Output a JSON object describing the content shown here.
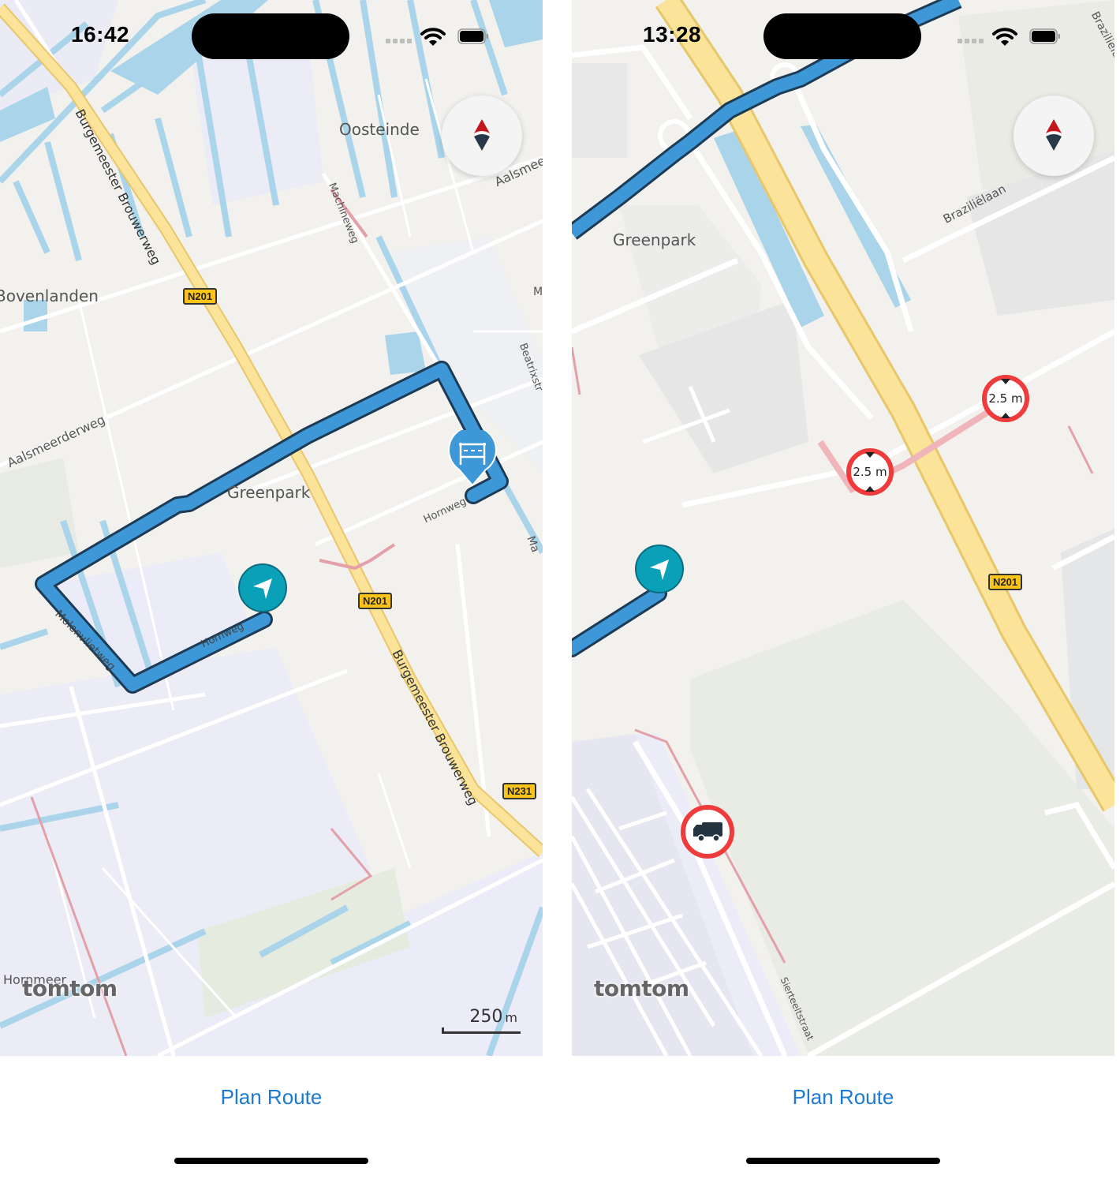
{
  "left_screen": {
    "status_bar": {
      "time": "16:42"
    },
    "map": {
      "place_labels": [
        "Oosteinde",
        "Bovenlanden",
        "Greenpark",
        "Hornmeer"
      ],
      "street_labels": [
        "Burgemeester Brouwerweg",
        "Machineweg",
        "Aalsmeerderweg",
        "Aalsmee",
        "Beatrixstr",
        "Hornweg",
        "Hornweg",
        "Molenvlietweg",
        "Burgemeester Brouwerweg",
        "Ma",
        "M"
      ],
      "road_shields": [
        "N201",
        "N201",
        "N231"
      ],
      "brand": "tomtom",
      "scale_label": "250",
      "scale_unit": "m"
    },
    "plan_route_label": "Plan Route"
  },
  "right_screen": {
    "status_bar": {
      "time": "13:28"
    },
    "map": {
      "place_labels": [
        "Greenpark"
      ],
      "street_labels": [
        "Braziliëlaan",
        "Braziliëlaa",
        "Sierteeltstraat"
      ],
      "road_shields": [
        "N201"
      ],
      "restriction_signs": [
        "2.5 m",
        "2.5 m"
      ],
      "brand": "tomtom"
    },
    "plan_route_label": "Plan Route"
  },
  "colors": {
    "route": "#3e97d6",
    "route_outline": "#1d3b55",
    "current_location": "#0aa0b8",
    "restriction_red": "#ef3b3b",
    "highway": "#fbe39a",
    "water": "#a9d4ea",
    "link_blue": "#1a7ad4"
  }
}
